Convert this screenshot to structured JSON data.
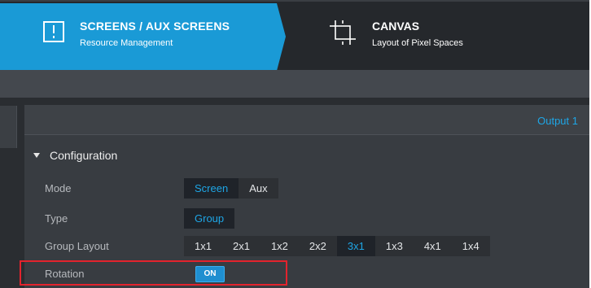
{
  "nav": {
    "tabs": [
      {
        "title": "SCREENS / AUX SCREENS",
        "subtitle": "Resource Management",
        "icon": "screens-icon",
        "active": true
      },
      {
        "title": "CANVAS",
        "subtitle": "Layout of Pixel Spaces",
        "icon": "canvas-crop-icon",
        "active": false
      }
    ]
  },
  "panel": {
    "output_label": "Output 1",
    "section_title": "Configuration",
    "rows": {
      "mode": {
        "label": "Mode",
        "options": [
          "Screen",
          "Aux"
        ],
        "selected": "Screen"
      },
      "type": {
        "label": "Type",
        "options": [
          "Group"
        ],
        "selected": "Group"
      },
      "group_layout": {
        "label": "Group Layout",
        "options": [
          "1x1",
          "2x1",
          "1x2",
          "2x2",
          "3x1",
          "1x3",
          "4x1",
          "1x4"
        ],
        "selected": "3x1"
      },
      "rotation": {
        "label": "Rotation",
        "toggle_label": "ON",
        "state": "on"
      }
    }
  },
  "colors": {
    "accent": "#1a9ad6",
    "selected_text": "#1ea6e6",
    "highlight": "#e3232d",
    "background": "#383c41"
  }
}
